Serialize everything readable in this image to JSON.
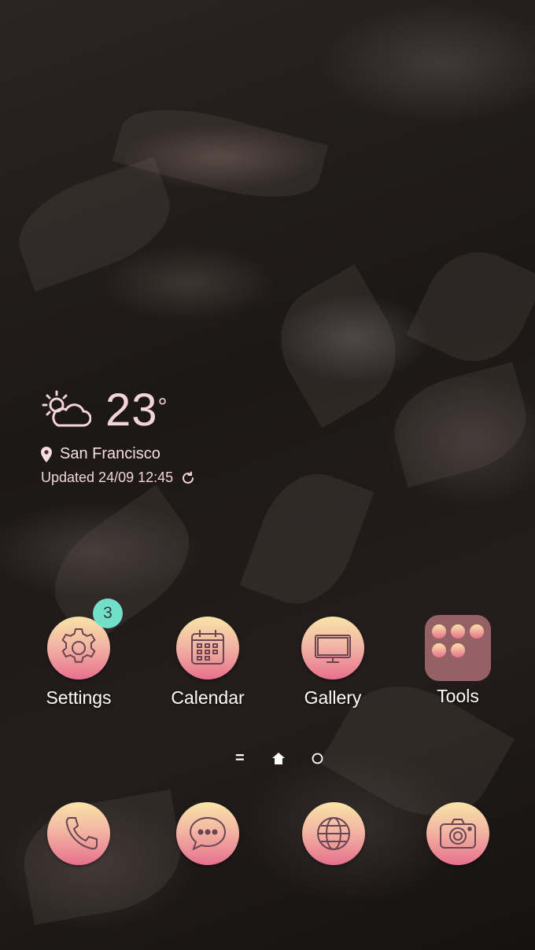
{
  "weather": {
    "temperature": "23",
    "degree_symbol": "°",
    "location": "San Francisco",
    "updated": "Updated 24/09 12:45",
    "icon": "partly-sunny-icon"
  },
  "apps": [
    {
      "label": "Settings",
      "icon": "gear-icon"
    },
    {
      "label": "Calendar",
      "icon": "calendar-icon"
    },
    {
      "label": "Gallery",
      "icon": "monitor-icon"
    },
    {
      "label": "Tools",
      "icon": "folder-icon"
    }
  ],
  "settings_badge": "3",
  "dock": [
    {
      "icon": "phone-icon"
    },
    {
      "icon": "messages-icon"
    },
    {
      "icon": "globe-icon"
    },
    {
      "icon": "camera-icon"
    }
  ],
  "page_indicator": [
    "menu",
    "home",
    "page"
  ],
  "colors": {
    "icon_gradient_top": "#f9e3a8",
    "icon_gradient_bottom": "#e8708d",
    "badge": "#72dfc9",
    "weather_text": "#f4d3da"
  }
}
